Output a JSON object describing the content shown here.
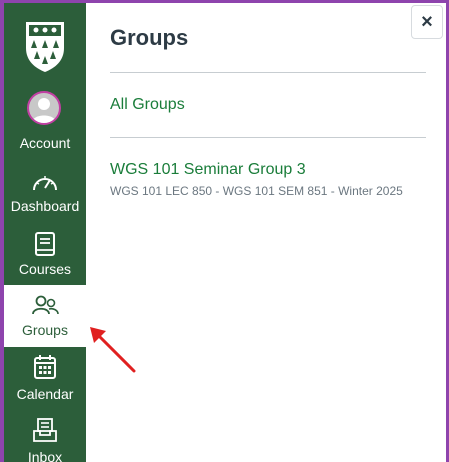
{
  "nav": {
    "account_label": "Account",
    "dashboard_label": "Dashboard",
    "courses_label": "Courses",
    "groups_label": "Groups",
    "calendar_label": "Calendar",
    "inbox_label": "Inbox"
  },
  "panel": {
    "title": "Groups",
    "all_groups_label": "All Groups",
    "group_name": "WGS 101 Seminar Group 3",
    "group_course": "WGS 101 LEC 850 - WGS 101 SEM 851 - Winter 2025",
    "close_symbol": "×"
  },
  "colors": {
    "sidebar": "#2c5e3a",
    "link": "#1a7d3a",
    "frame": "#8e44ad",
    "annotation_arrow": "#e02020"
  }
}
